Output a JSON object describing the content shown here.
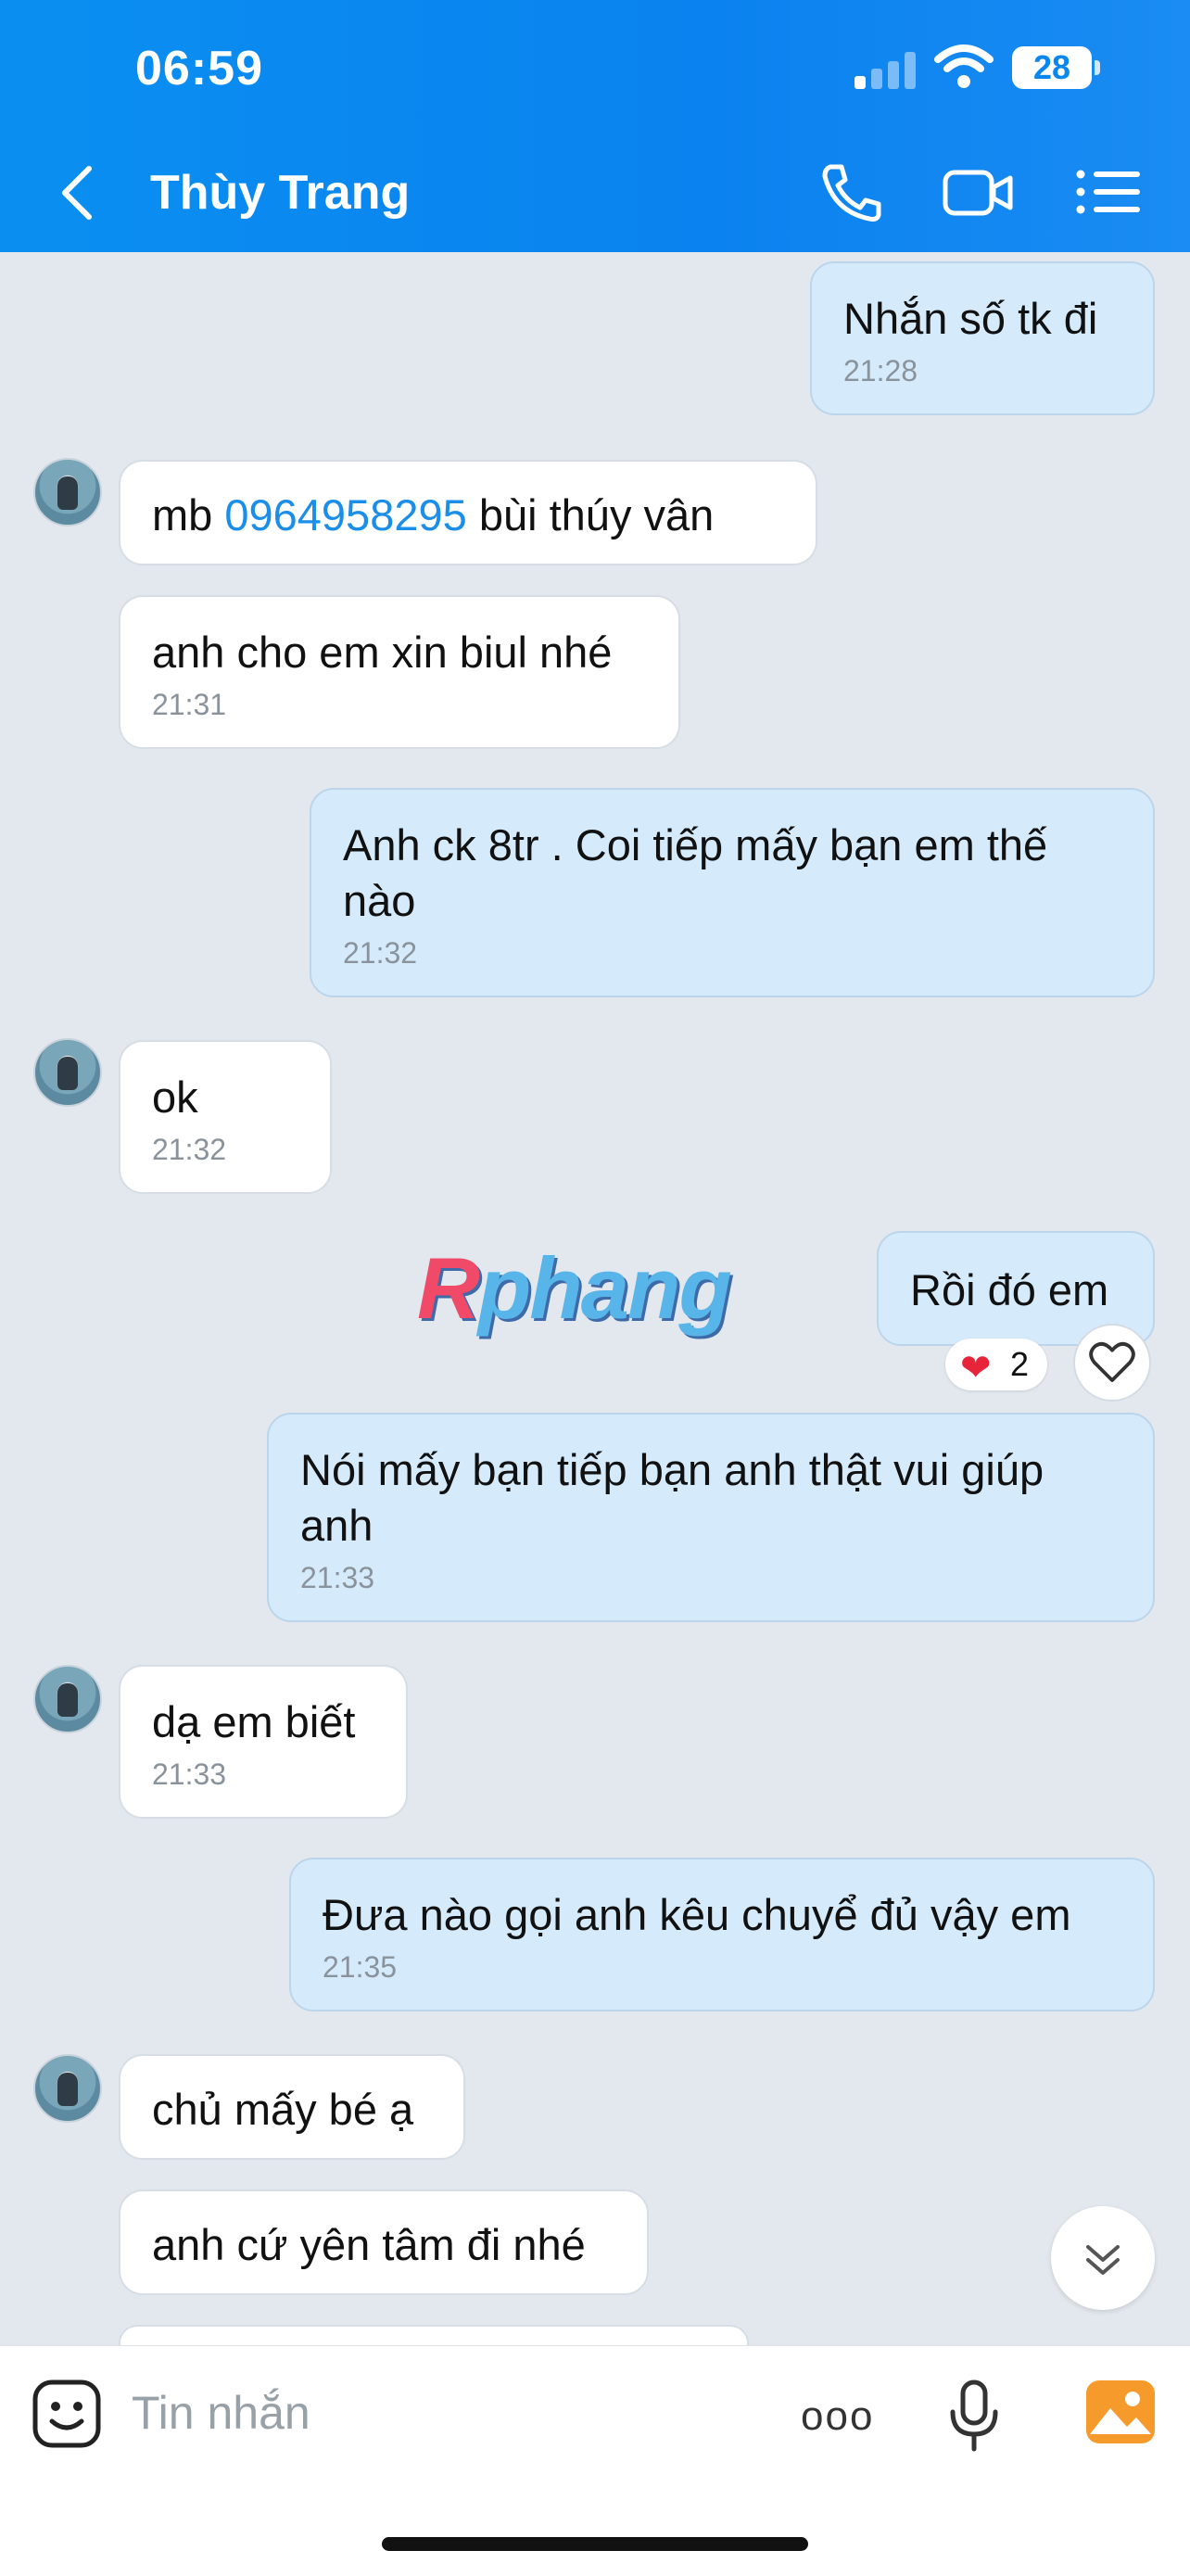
{
  "status_bar": {
    "time": "06:59",
    "battery": "28"
  },
  "header": {
    "contact_name": "Thùy Trang"
  },
  "messages": [
    {
      "dir": "out",
      "text": "Nhắn số tk đi",
      "time": "21:28"
    },
    {
      "dir": "in",
      "pre": "mb ",
      "link": "0964958295",
      "post": " bùi thúy vân"
    },
    {
      "dir": "in",
      "text": "anh cho em xin biul nhé",
      "time": "21:31"
    },
    {
      "dir": "out",
      "text": "Anh ck 8tr . Coi tiếp mấy bạn em thế nào",
      "time": "21:32"
    },
    {
      "dir": "in",
      "text": "ok",
      "time": "21:32"
    },
    {
      "dir": "out",
      "text": "Rồi đó em"
    },
    {
      "dir": "out",
      "text": "Nói mấy bạn tiếp bạn anh thật vui giúp anh",
      "time": "21:33"
    },
    {
      "dir": "in",
      "text": "dạ em biết",
      "time": "21:33"
    },
    {
      "dir": "out",
      "text": "Đưa nào gọi anh kêu chuyể đủ vậy em",
      "time": "21:35"
    },
    {
      "dir": "in",
      "text": "chủ mấy bé ạ"
    },
    {
      "dir": "in",
      "text": "anh cứ yên tâm đi nhé"
    }
  ],
  "reaction": {
    "emoji": "❤",
    "count": "2"
  },
  "watermark": {
    "r": "R",
    "rest": "phang"
  },
  "composer": {
    "placeholder": "Tin nhắn",
    "more": "ooo"
  }
}
